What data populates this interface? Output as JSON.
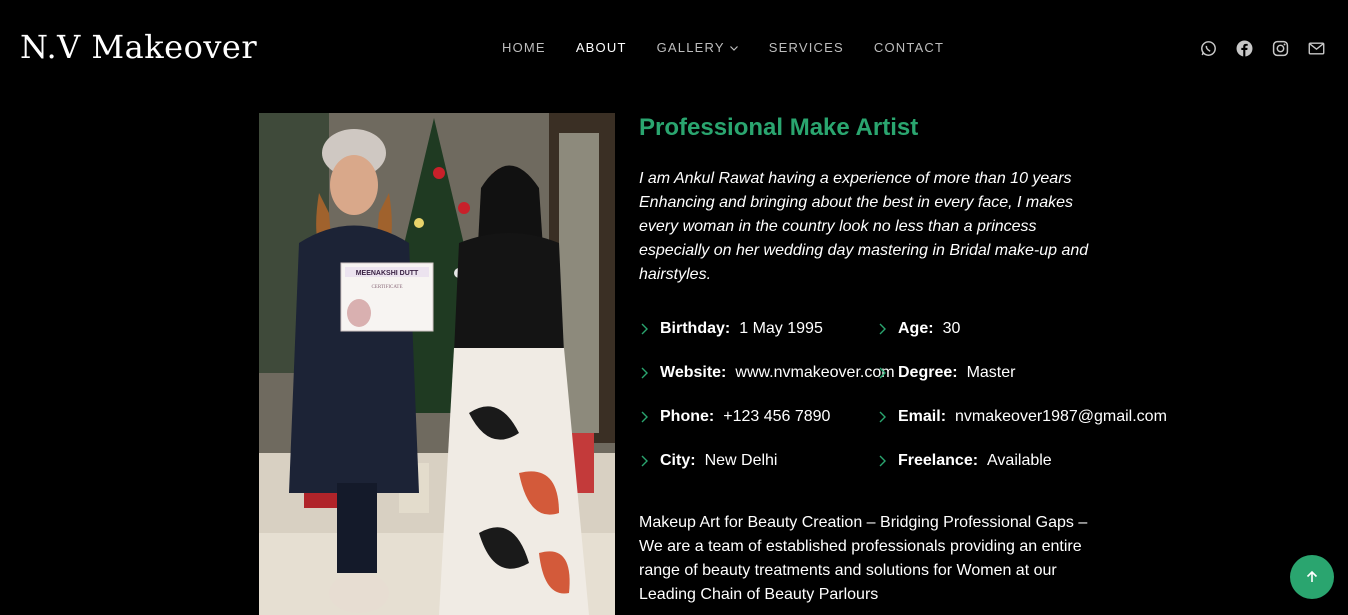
{
  "header": {
    "logo": "N.V Makeover",
    "nav": [
      {
        "label": "HOME"
      },
      {
        "label": "ABOUT"
      },
      {
        "label": "GALLERY"
      },
      {
        "label": "SERVICES"
      },
      {
        "label": "CONTACT"
      }
    ],
    "socials": [
      "whatsapp-icon",
      "facebook-icon",
      "instagram-icon",
      "mail-icon"
    ]
  },
  "photo": {
    "certificate_name": "MEENAKSHI DUTT",
    "certificate_title": "CERTIFICATE"
  },
  "about": {
    "title": "Professional Make Artist",
    "intro": "I am Ankul Rawat having a experience of more than 10 years Enhancing and bringing about the best in every face, I makes every woman in the country look no less than a princess especially on her wedding day mastering in Bridal make-up and hairstyles.",
    "info": [
      {
        "label": "Birthday:",
        "value": "1 May 1995"
      },
      {
        "label": "Age:",
        "value": "30"
      },
      {
        "label": "Website:",
        "value": "www.nvmakeover.com"
      },
      {
        "label": "Degree:",
        "value": "Master"
      },
      {
        "label": "Phone:",
        "value": "+123 456 7890"
      },
      {
        "label": "Email:",
        "value": "nvmakeover1987@gmail.com"
      },
      {
        "label": "City:",
        "value": "New Delhi"
      },
      {
        "label": "Freelance:",
        "value": "Available"
      }
    ],
    "description": "Makeup Art for Beauty Creation – Bridging Professional Gaps – We are a team of established professionals providing an entire range of beauty treatments and solutions for Women at our Leading Chain of Beauty Parlours"
  },
  "colors": {
    "accent": "#2aa56f",
    "background": "#000000",
    "nav_inactive": "#bdbdbd"
  }
}
